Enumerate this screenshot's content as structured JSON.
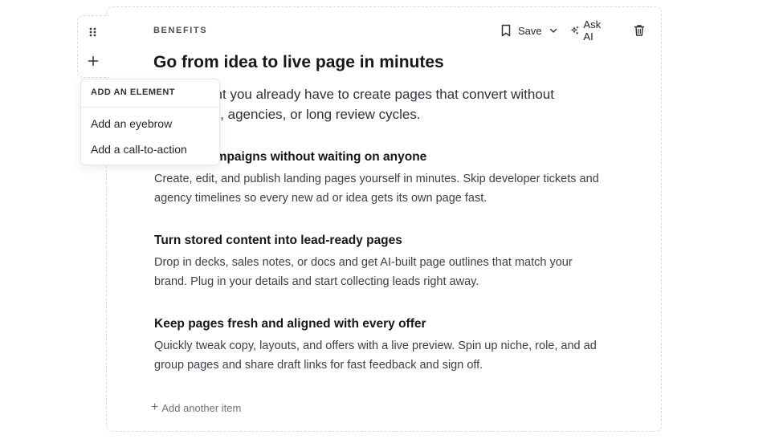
{
  "block": {
    "eyebrow": "BENEFITS",
    "title": "Go from idea to live page in minutes",
    "lead": "Use content you already have to create pages that convert without developers, agencies, or long review cycles.",
    "items": [
      {
        "heading": "Launch campaigns without waiting on anyone",
        "body": "Create, edit, and publish landing pages yourself in minutes. Skip developer tickets and agency timelines so every new ad or idea gets its own page fast."
      },
      {
        "heading": "Turn stored content into lead-ready pages",
        "body": "Drop in decks, sales notes, or docs and get AI-built page outlines that match your brand. Plug in your details and start collecting leads right away."
      },
      {
        "heading": "Keep pages fresh and aligned with every offer",
        "body": "Quickly tweak copy, layouts, and offers with a live preview. Spin up niche, role, and ad group pages and share draft links for fast feedback and sign off."
      }
    ],
    "add_item_label": "Add another item"
  },
  "toolbar": {
    "save_label": "Save",
    "ask_ai_label": "Ask AI"
  },
  "menu": {
    "header": "ADD AN ELEMENT",
    "items": [
      {
        "label": "Add an eyebrow"
      },
      {
        "label": "Add a call-to-action"
      }
    ]
  },
  "icons": {
    "drag": "drag-handle-icon",
    "add": "plus-icon",
    "save": "bookmark-icon",
    "chevron": "chevron-down-icon",
    "ask_ai": "sparkles-icon",
    "delete": "trash-icon"
  }
}
